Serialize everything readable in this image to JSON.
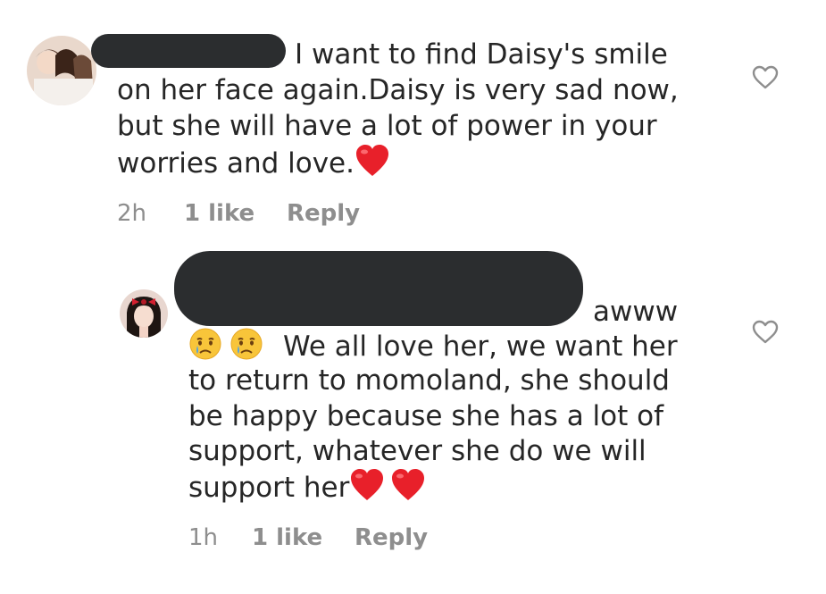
{
  "comments": [
    {
      "avatar_alt": "profile photo of three people",
      "lines": [
        "I want to find Daisy's smile",
        "on her face again.Daisy is very sad now,",
        "but she will have a lot of power in your",
        "worries and love."
      ],
      "time": "2h",
      "likes": "1 like",
      "reply_label": "Reply"
    },
    {
      "avatar_alt": "profile photo of a girl with a red bow",
      "lines": [
        "awww",
        "We all love her, we want her",
        "to return to momoland, she should",
        "be happy because she has a lot of",
        "support, whatever she do we will",
        "support her"
      ],
      "time": "1h",
      "likes": "1 like",
      "reply_label": "Reply"
    }
  ],
  "colors": {
    "text": "#262626",
    "meta": "#8e8e8e",
    "redaction": "#2b2d2f",
    "heart_red": "#e8202a"
  },
  "icons": [
    "heart-outline-icon",
    "red-heart-emoji",
    "crying-face-emoji"
  ]
}
